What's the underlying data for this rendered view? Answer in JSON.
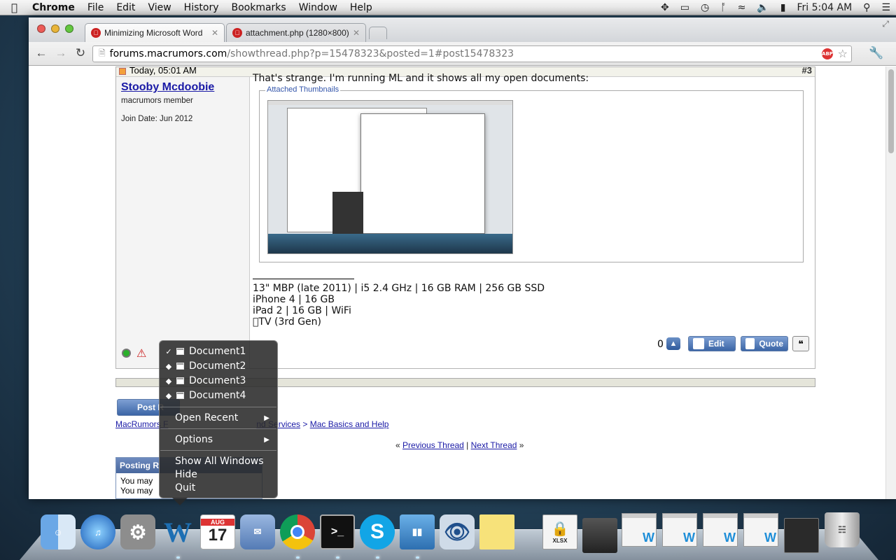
{
  "menubar": {
    "app": "Chrome",
    "items": [
      "File",
      "Edit",
      "View",
      "History",
      "Bookmarks",
      "Window",
      "Help"
    ],
    "clock": "Fri 5:04 AM"
  },
  "browser": {
    "tabs": [
      {
        "title": "Minimizing Microsoft Word"
      },
      {
        "title": "attachment.php (1280×800)"
      }
    ],
    "url_host": "forums.macrumors.com",
    "url_path": "/showthread.php?p=15478323&posted=1#post15478323",
    "abp_label": "ABP"
  },
  "post": {
    "date": "Today, 05:01 AM",
    "number": "#3",
    "username": "Stooby Mcdoobie",
    "user_title": "macrumors member",
    "join_date": "Join Date: Jun 2012",
    "message": "That's strange. I'm running ML and it shows all my open documents:",
    "attach_legend": "Attached Thumbnails",
    "signature": [
      "13\" MBP (late 2011) | i5 2.4 GHz | 16 GB RAM | 256 GB SSD",
      "iPhone 4 | 16 GB",
      "iPad 2 | 16 GB | WiFi",
      "TV (3rd Gen)"
    ],
    "vote_count": "0",
    "edit_label": "Edit",
    "quote_label": "Quote"
  },
  "page": {
    "post_reply": "Post R",
    "breadcrumb_left": "MacRumors F",
    "breadcrumb_mid": "nd Services",
    "breadcrumb_last": "Mac Basics and Help",
    "prev_thread": "Previous Thread",
    "next_thread": "Next Thread",
    "rules_header": "Posting R",
    "rules_line1": "You may",
    "rules_line2": "You may"
  },
  "context_menu": {
    "documents": [
      "Document1",
      "Document2",
      "Document3",
      "Document4"
    ],
    "open_recent": "Open Recent",
    "options": "Options",
    "show_all": "Show All Windows",
    "hide": "Hide",
    "quit": "Quit"
  },
  "dock": {
    "calendar_month": "AUG",
    "calendar_day": "17",
    "xlsx_label": "XLSX"
  }
}
